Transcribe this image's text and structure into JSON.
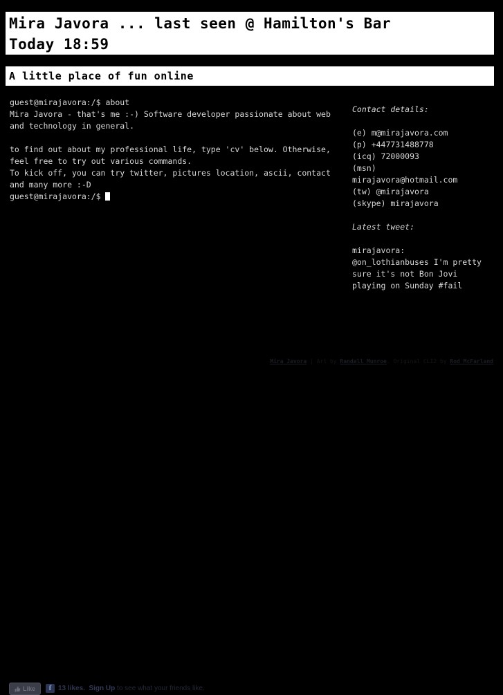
{
  "header": {
    "title_lines": [
      "Mira Javora ... last seen @ Hamilton's Bar",
      "Today 18:59"
    ],
    "subtitle": "A little place of fun online"
  },
  "terminal": {
    "lines": [
      "guest@mirajavora:/$ about",
      "Mira Javora - that's me :-) Software developer passionate about web",
      "and technology in general.",
      "",
      "to find out about my professional life, type 'cv' below. Otherwise,",
      "feel free to try out various commands.",
      "To kick off, you can try twitter, pictures location, ascii, contact",
      "and many more :-D"
    ],
    "prompt": "guest@mirajavora:/$ ",
    "cursor": "block-cursor"
  },
  "sidebar": {
    "contact_heading": "Contact details:",
    "contact_lines": [
      "(e) m@mirajavora.com",
      "(p) +447731488778",
      "(icq) 72000093",
      "(msn)",
      "mirajavora@hotmail.com",
      "(tw) @mirajavora",
      "(skype) mirajavora"
    ],
    "tweet_heading": "Latest tweet:",
    "tweet_author": "mirajavora:",
    "tweet_lines": [
      "@on_lothianbuses I'm pretty",
      "sure it's not Bon Jovi",
      "playing on Sunday #fail"
    ]
  },
  "social": {
    "like_label": "Like",
    "like_icon": "thumbs-up-icon",
    "fb_badge": "f",
    "likes_count": "13 likes.",
    "signup_label": "Sign Up",
    "tail_text": " to see what your friends like."
  },
  "credits": {
    "site_link": "Mira Javora",
    "separator": " | Art by ",
    "artist_link": "Randall Munroe",
    "middle_text": ". Original CLI2 by ",
    "author_link": "Rod McFarland"
  },
  "colors": {
    "background": "#000000",
    "bar_background": "#ffffff",
    "bar_text": "#000000",
    "terminal_text": "#d8d8d8",
    "cursor": "#ffffff",
    "fb_badge": "#2b3553",
    "like_button": "#3b3d48"
  }
}
